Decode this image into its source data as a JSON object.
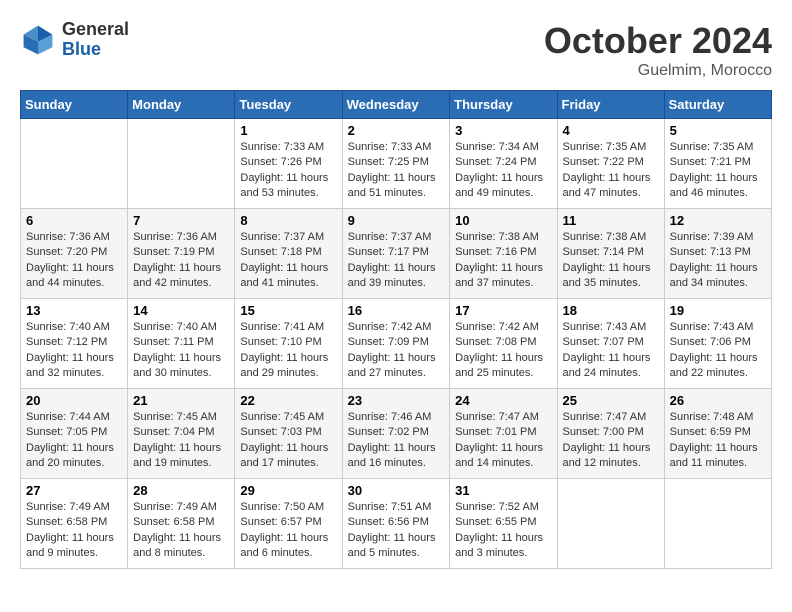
{
  "logo": {
    "general": "General",
    "blue": "Blue"
  },
  "header": {
    "month": "October 2024",
    "location": "Guelmim, Morocco"
  },
  "weekdays": [
    "Sunday",
    "Monday",
    "Tuesday",
    "Wednesday",
    "Thursday",
    "Friday",
    "Saturday"
  ],
  "weeks": [
    [
      {
        "day": "",
        "sunrise": "",
        "sunset": "",
        "daylight": ""
      },
      {
        "day": "",
        "sunrise": "",
        "sunset": "",
        "daylight": ""
      },
      {
        "day": "1",
        "sunrise": "Sunrise: 7:33 AM",
        "sunset": "Sunset: 7:26 PM",
        "daylight": "Daylight: 11 hours and 53 minutes."
      },
      {
        "day": "2",
        "sunrise": "Sunrise: 7:33 AM",
        "sunset": "Sunset: 7:25 PM",
        "daylight": "Daylight: 11 hours and 51 minutes."
      },
      {
        "day": "3",
        "sunrise": "Sunrise: 7:34 AM",
        "sunset": "Sunset: 7:24 PM",
        "daylight": "Daylight: 11 hours and 49 minutes."
      },
      {
        "day": "4",
        "sunrise": "Sunrise: 7:35 AM",
        "sunset": "Sunset: 7:22 PM",
        "daylight": "Daylight: 11 hours and 47 minutes."
      },
      {
        "day": "5",
        "sunrise": "Sunrise: 7:35 AM",
        "sunset": "Sunset: 7:21 PM",
        "daylight": "Daylight: 11 hours and 46 minutes."
      }
    ],
    [
      {
        "day": "6",
        "sunrise": "Sunrise: 7:36 AM",
        "sunset": "Sunset: 7:20 PM",
        "daylight": "Daylight: 11 hours and 44 minutes."
      },
      {
        "day": "7",
        "sunrise": "Sunrise: 7:36 AM",
        "sunset": "Sunset: 7:19 PM",
        "daylight": "Daylight: 11 hours and 42 minutes."
      },
      {
        "day": "8",
        "sunrise": "Sunrise: 7:37 AM",
        "sunset": "Sunset: 7:18 PM",
        "daylight": "Daylight: 11 hours and 41 minutes."
      },
      {
        "day": "9",
        "sunrise": "Sunrise: 7:37 AM",
        "sunset": "Sunset: 7:17 PM",
        "daylight": "Daylight: 11 hours and 39 minutes."
      },
      {
        "day": "10",
        "sunrise": "Sunrise: 7:38 AM",
        "sunset": "Sunset: 7:16 PM",
        "daylight": "Daylight: 11 hours and 37 minutes."
      },
      {
        "day": "11",
        "sunrise": "Sunrise: 7:38 AM",
        "sunset": "Sunset: 7:14 PM",
        "daylight": "Daylight: 11 hours and 35 minutes."
      },
      {
        "day": "12",
        "sunrise": "Sunrise: 7:39 AM",
        "sunset": "Sunset: 7:13 PM",
        "daylight": "Daylight: 11 hours and 34 minutes."
      }
    ],
    [
      {
        "day": "13",
        "sunrise": "Sunrise: 7:40 AM",
        "sunset": "Sunset: 7:12 PM",
        "daylight": "Daylight: 11 hours and 32 minutes."
      },
      {
        "day": "14",
        "sunrise": "Sunrise: 7:40 AM",
        "sunset": "Sunset: 7:11 PM",
        "daylight": "Daylight: 11 hours and 30 minutes."
      },
      {
        "day": "15",
        "sunrise": "Sunrise: 7:41 AM",
        "sunset": "Sunset: 7:10 PM",
        "daylight": "Daylight: 11 hours and 29 minutes."
      },
      {
        "day": "16",
        "sunrise": "Sunrise: 7:42 AM",
        "sunset": "Sunset: 7:09 PM",
        "daylight": "Daylight: 11 hours and 27 minutes."
      },
      {
        "day": "17",
        "sunrise": "Sunrise: 7:42 AM",
        "sunset": "Sunset: 7:08 PM",
        "daylight": "Daylight: 11 hours and 25 minutes."
      },
      {
        "day": "18",
        "sunrise": "Sunrise: 7:43 AM",
        "sunset": "Sunset: 7:07 PM",
        "daylight": "Daylight: 11 hours and 24 minutes."
      },
      {
        "day": "19",
        "sunrise": "Sunrise: 7:43 AM",
        "sunset": "Sunset: 7:06 PM",
        "daylight": "Daylight: 11 hours and 22 minutes."
      }
    ],
    [
      {
        "day": "20",
        "sunrise": "Sunrise: 7:44 AM",
        "sunset": "Sunset: 7:05 PM",
        "daylight": "Daylight: 11 hours and 20 minutes."
      },
      {
        "day": "21",
        "sunrise": "Sunrise: 7:45 AM",
        "sunset": "Sunset: 7:04 PM",
        "daylight": "Daylight: 11 hours and 19 minutes."
      },
      {
        "day": "22",
        "sunrise": "Sunrise: 7:45 AM",
        "sunset": "Sunset: 7:03 PM",
        "daylight": "Daylight: 11 hours and 17 minutes."
      },
      {
        "day": "23",
        "sunrise": "Sunrise: 7:46 AM",
        "sunset": "Sunset: 7:02 PM",
        "daylight": "Daylight: 11 hours and 16 minutes."
      },
      {
        "day": "24",
        "sunrise": "Sunrise: 7:47 AM",
        "sunset": "Sunset: 7:01 PM",
        "daylight": "Daylight: 11 hours and 14 minutes."
      },
      {
        "day": "25",
        "sunrise": "Sunrise: 7:47 AM",
        "sunset": "Sunset: 7:00 PM",
        "daylight": "Daylight: 11 hours and 12 minutes."
      },
      {
        "day": "26",
        "sunrise": "Sunrise: 7:48 AM",
        "sunset": "Sunset: 6:59 PM",
        "daylight": "Daylight: 11 hours and 11 minutes."
      }
    ],
    [
      {
        "day": "27",
        "sunrise": "Sunrise: 7:49 AM",
        "sunset": "Sunset: 6:58 PM",
        "daylight": "Daylight: 11 hours and 9 minutes."
      },
      {
        "day": "28",
        "sunrise": "Sunrise: 7:49 AM",
        "sunset": "Sunset: 6:58 PM",
        "daylight": "Daylight: 11 hours and 8 minutes."
      },
      {
        "day": "29",
        "sunrise": "Sunrise: 7:50 AM",
        "sunset": "Sunset: 6:57 PM",
        "daylight": "Daylight: 11 hours and 6 minutes."
      },
      {
        "day": "30",
        "sunrise": "Sunrise: 7:51 AM",
        "sunset": "Sunset: 6:56 PM",
        "daylight": "Daylight: 11 hours and 5 minutes."
      },
      {
        "day": "31",
        "sunrise": "Sunrise: 7:52 AM",
        "sunset": "Sunset: 6:55 PM",
        "daylight": "Daylight: 11 hours and 3 minutes."
      },
      {
        "day": "",
        "sunrise": "",
        "sunset": "",
        "daylight": ""
      },
      {
        "day": "",
        "sunrise": "",
        "sunset": "",
        "daylight": ""
      }
    ]
  ]
}
